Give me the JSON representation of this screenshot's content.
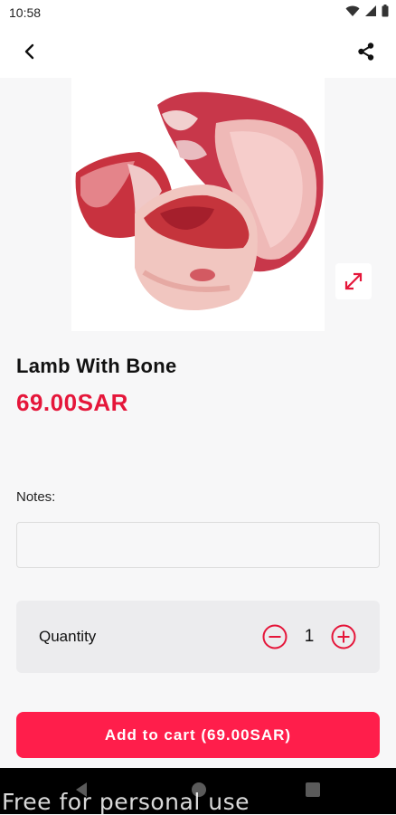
{
  "status_bar": {
    "time": "10:58",
    "icons": [
      "wifi-icon",
      "signal-icon",
      "battery-icon"
    ]
  },
  "app_bar": {
    "back_icon": "back-arrow-icon",
    "share_icon": "share-icon"
  },
  "product": {
    "image": "lamb-with-bone-photo",
    "expand_icon": "expand-icon",
    "title": "Lamb With Bone",
    "price": "69.00SAR"
  },
  "notes": {
    "label": "Notes:",
    "value": "",
    "placeholder": ""
  },
  "quantity": {
    "label": "Quantity",
    "value": "1",
    "minus_icon": "minus-circle-icon",
    "plus_icon": "plus-circle-icon"
  },
  "cart": {
    "button_label": "Add to cart (69.00SAR)"
  },
  "nav_bar": {
    "icons": [
      "nav-back-icon",
      "nav-home-icon",
      "nav-recents-icon"
    ]
  },
  "watermark": "Free for personal use",
  "colors": {
    "accent": "#ff1e4b",
    "price": "#e5163a",
    "background": "#f7f7f8",
    "quantity_panel": "#ececee"
  }
}
